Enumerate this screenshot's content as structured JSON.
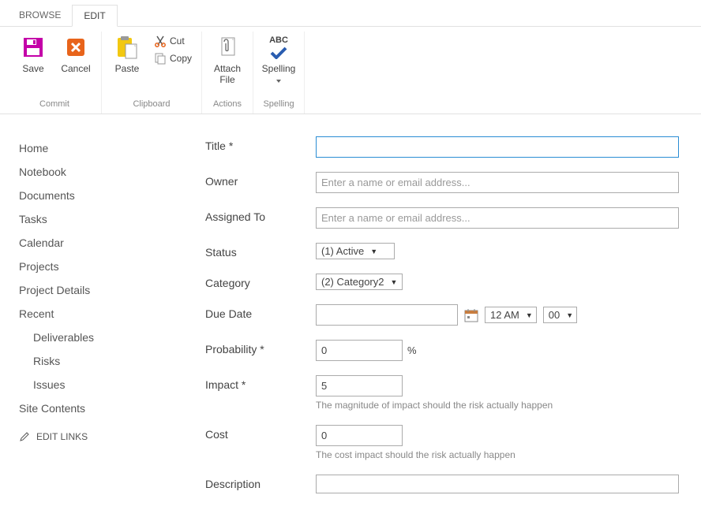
{
  "tabs": {
    "browse": "BROWSE",
    "edit": "EDIT"
  },
  "ribbon": {
    "commit": {
      "group_label": "Commit",
      "save": "Save",
      "cancel": "Cancel"
    },
    "clipboard": {
      "group_label": "Clipboard",
      "paste": "Paste",
      "cut": "Cut",
      "copy": "Copy"
    },
    "actions": {
      "group_label": "Actions",
      "attach_file": "Attach File"
    },
    "spelling": {
      "group_label": "Spelling",
      "spelling": "Spelling",
      "abc": "ABC"
    }
  },
  "sidebar": {
    "items": [
      {
        "label": "Home"
      },
      {
        "label": "Notebook"
      },
      {
        "label": "Documents"
      },
      {
        "label": "Tasks"
      },
      {
        "label": "Calendar"
      },
      {
        "label": "Projects"
      },
      {
        "label": "Project Details"
      },
      {
        "label": "Recent"
      }
    ],
    "recent_sub": [
      {
        "label": "Deliverables"
      },
      {
        "label": "Risks"
      },
      {
        "label": "Issues"
      }
    ],
    "site_contents": "Site Contents",
    "edit_links": "EDIT LINKS"
  },
  "form": {
    "title": {
      "label": "Title *",
      "value": ""
    },
    "owner": {
      "label": "Owner",
      "placeholder": "Enter a name or email address..."
    },
    "assigned_to": {
      "label": "Assigned To",
      "placeholder": "Enter a name or email address..."
    },
    "status": {
      "label": "Status",
      "value": "(1) Active"
    },
    "category": {
      "label": "Category",
      "value": "(2) Category2"
    },
    "due_date": {
      "label": "Due Date",
      "value": "",
      "hour": "12 AM",
      "minute": "00"
    },
    "probability": {
      "label": "Probability *",
      "value": "0",
      "unit": "%"
    },
    "impact": {
      "label": "Impact *",
      "value": "5",
      "help": "The magnitude of impact should the risk actually happen"
    },
    "cost": {
      "label": "Cost",
      "value": "0",
      "help": "The cost impact should the risk actually happen"
    },
    "description": {
      "label": "Description",
      "value": ""
    }
  }
}
